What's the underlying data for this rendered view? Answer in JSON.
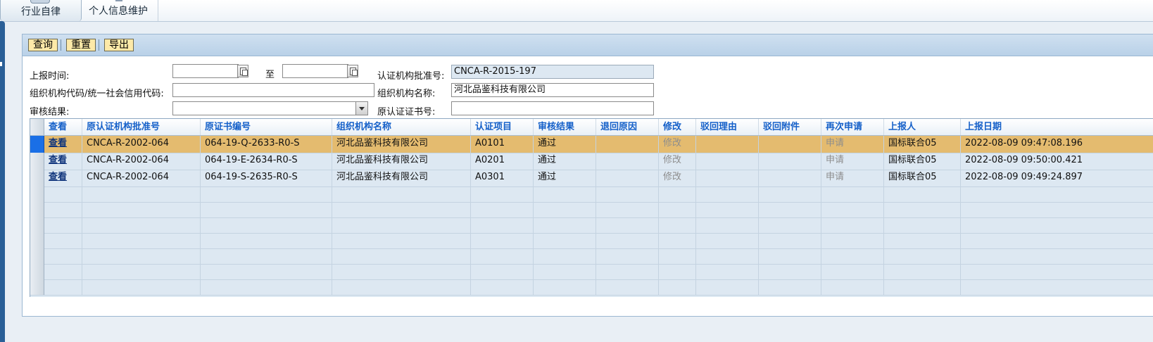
{
  "top_tabs": [
    {
      "label": "行业自律",
      "active": true,
      "icon": "folder-icon"
    },
    {
      "label": "个人信息维护",
      "active": false,
      "icon": "person-icon"
    }
  ],
  "toolbar": {
    "query_label": "查询",
    "reset_label": "重置",
    "export_label": "导出"
  },
  "form": {
    "report_time_label": "上报时间:",
    "report_time_from": "",
    "to_label": "至",
    "report_time_to": "",
    "cert_org_approval_label": "认证机构批准号:",
    "cert_org_approval_value": "CNCA-R-2015-197",
    "org_code_label": "组织机构代码/统一社会信用代码:",
    "org_code_value": "",
    "org_name_label": "组织机构名称:",
    "org_name_value": "河北品鉴科技有限公司",
    "review_result_label": "审核结果:",
    "review_result_value": "",
    "orig_cert_no_label": "原认证证书号:",
    "orig_cert_no_value": ""
  },
  "grid": {
    "columns": [
      "查看",
      "原认证机构批准号",
      "原证书编号",
      "组织机构名称",
      "认证项目",
      "审核结果",
      "退回原因",
      "修改",
      "驳回理由",
      "驳回附件",
      "再次申请",
      "上报人",
      "上报日期"
    ],
    "rows": [
      {
        "view": "查看",
        "orig_approval": "CNCA-R-2002-064",
        "orig_cert": "064-19-Q-2633-R0-S",
        "org_name": "河北品鉴科技有限公司",
        "project": "A0101",
        "result": "通过",
        "return_reason": "",
        "modify": "修改",
        "reject_reason": "",
        "reject_attach": "",
        "reapply": "申请",
        "reporter": "国标联合05",
        "report_date": "2022-08-09 09:47:08.196",
        "selected": true
      },
      {
        "view": "查看",
        "orig_approval": "CNCA-R-2002-064",
        "orig_cert": "064-19-E-2634-R0-S",
        "org_name": "河北品鉴科技有限公司",
        "project": "A0201",
        "result": "通过",
        "return_reason": "",
        "modify": "修改",
        "reject_reason": "",
        "reject_attach": "",
        "reapply": "申请",
        "reporter": "国标联合05",
        "report_date": "2022-08-09 09:50:00.421",
        "selected": false
      },
      {
        "view": "查看",
        "orig_approval": "CNCA-R-2002-064",
        "orig_cert": "064-19-S-2635-R0-S",
        "org_name": "河北品鉴科技有限公司",
        "project": "A0301",
        "result": "通过",
        "return_reason": "",
        "modify": "修改",
        "reject_reason": "",
        "reject_attach": "",
        "reapply": "申请",
        "reporter": "国标联合05",
        "report_date": "2022-08-09 09:49:24.897",
        "selected": false
      }
    ]
  },
  "colors": {
    "selected_row": "#e4bb6f",
    "header_text": "#1560c9",
    "toolbar_button": "#fde9a8",
    "panel_header": "#b9d1e8",
    "left_strip": "#2a5f97"
  }
}
